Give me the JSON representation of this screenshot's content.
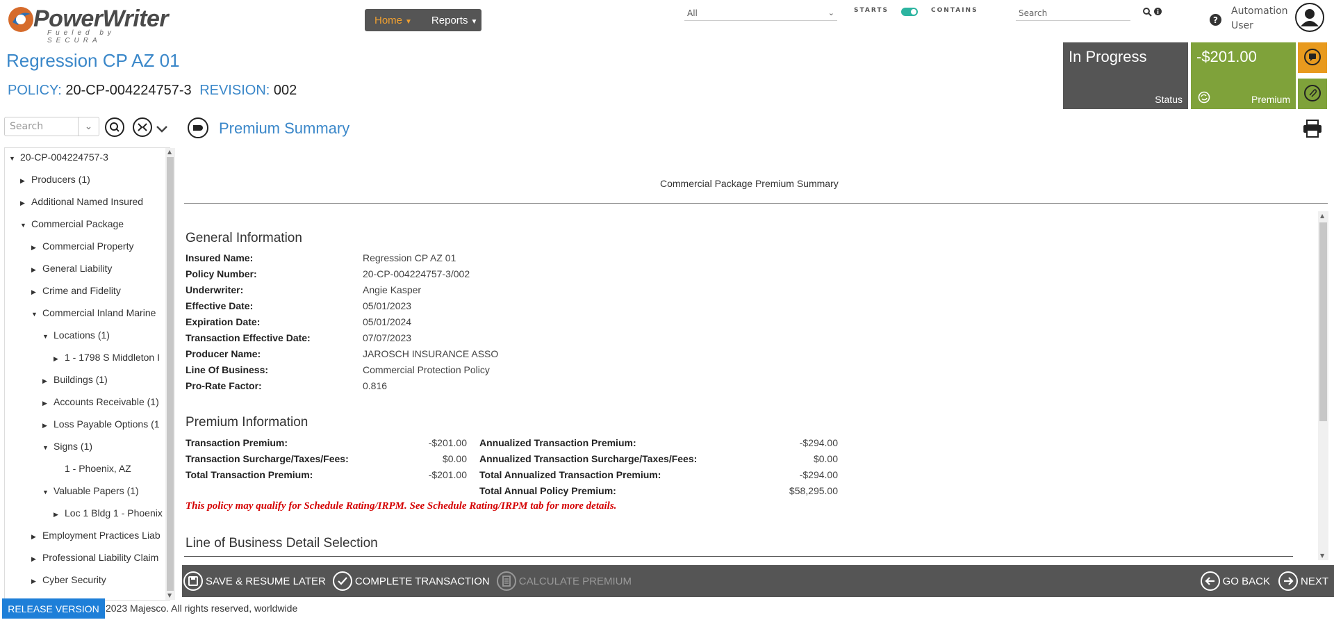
{
  "header": {
    "logo_text": "PowerWriter",
    "logo_tag": "Fueled by SECURA",
    "nav": [
      {
        "label": "Home"
      },
      {
        "label": "Reports"
      }
    ],
    "lob_select": "All",
    "starts_label": "STARTS",
    "contains_label": "CONTAINS",
    "search_placeholder": "Search",
    "user_line1": "Automation",
    "user_line2": "User"
  },
  "page": {
    "title": "Regression CP AZ 01",
    "policy_label": "POLICY:",
    "policy_value": "20-CP-004224757-3",
    "revision_label": "REVISION:",
    "revision_value": "002"
  },
  "tiles": {
    "status_value": "In Progress",
    "status_label": "Status",
    "premium_value": "-$201.00",
    "premium_label": "Premium"
  },
  "tree_search_placeholder": "Search",
  "tree": [
    {
      "label": "20-CP-004224757-3"
    },
    {
      "label": "Producers (1)"
    },
    {
      "label": "Additional Named Insured"
    },
    {
      "label": "Commercial Package"
    },
    {
      "label": "Commercial Property"
    },
    {
      "label": "General Liability"
    },
    {
      "label": "Crime and Fidelity"
    },
    {
      "label": "Commercial Inland Marine"
    },
    {
      "label": "Locations (1)"
    },
    {
      "label": "1 - 1798 S Middleton I"
    },
    {
      "label": "Buildings (1)"
    },
    {
      "label": "Accounts Receivable (1)"
    },
    {
      "label": "Loss Payable Options (1"
    },
    {
      "label": "Signs (1)"
    },
    {
      "label": "1 - Phoenix, AZ"
    },
    {
      "label": "Valuable Papers (1)"
    },
    {
      "label": "Loc 1 Bldg 1 - Phoenix"
    },
    {
      "label": "Employment Practices Liab"
    },
    {
      "label": "Professional Liability Claim"
    },
    {
      "label": "Cyber Security"
    }
  ],
  "section_title": "Premium Summary",
  "report_title": "Commercial Package Premium Summary",
  "general": {
    "heading": "General Information",
    "rows": [
      {
        "label": "Insured Name:",
        "value": "Regression CP AZ 01"
      },
      {
        "label": "Policy Number:",
        "value": "20-CP-004224757-3/002"
      },
      {
        "label": "Underwriter:",
        "value": "Angie Kasper"
      },
      {
        "label": "Effective Date:",
        "value": "05/01/2023"
      },
      {
        "label": "Expiration Date:",
        "value": "05/01/2024"
      },
      {
        "label": "Transaction Effective Date:",
        "value": "07/07/2023"
      },
      {
        "label": "Producer Name:",
        "value": "JAROSCH INSURANCE ASSO"
      },
      {
        "label": "Line Of Business:",
        "value": "Commercial Protection Policy"
      },
      {
        "label": "Pro-Rate Factor:",
        "value": "0.816"
      }
    ]
  },
  "premium": {
    "heading": "Premium Information",
    "left": [
      {
        "label": "Transaction Premium:",
        "value": "-$201.00"
      },
      {
        "label": "Transaction Surcharge/Taxes/Fees:",
        "value": "$0.00"
      },
      {
        "label": "Total Transaction Premium:",
        "value": "-$201.00"
      }
    ],
    "right": [
      {
        "label": "Annualized Transaction Premium:",
        "value": "-$294.00"
      },
      {
        "label": "Annualized Transaction Surcharge/Taxes/Fees:",
        "value": "$0.00"
      },
      {
        "label": "Total Annualized Transaction Premium:",
        "value": "-$294.00"
      },
      {
        "label": "Total Annual Policy Premium:",
        "value": "$58,295.00"
      }
    ],
    "note": "This policy may qualify for Schedule Rating/IRPM. See Schedule Rating/IRPM tab for more details."
  },
  "lob_heading": "Line of Business Detail Selection",
  "actions": {
    "save": "SAVE & RESUME LATER",
    "complete": "COMPLETE TRANSACTION",
    "calculate": "CALCULATE PREMIUM",
    "back": "GO BACK",
    "next": "NEXT"
  },
  "footer": {
    "release": "RELEASE VERSION",
    "copyright": "2023 Majesco. All rights reserved, worldwide"
  },
  "colors": {
    "accent": "#3a87c9",
    "status_tile": "#555555",
    "premium_tile": "#7fa23a",
    "notes_tile": "#e89a1e",
    "note_text": "#d40000"
  }
}
